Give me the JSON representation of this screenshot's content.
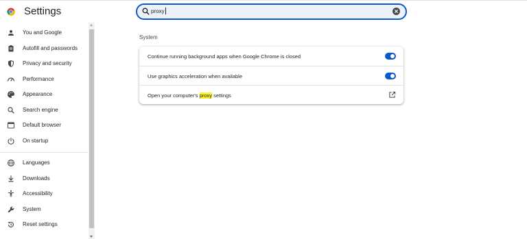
{
  "app": {
    "title": "Settings"
  },
  "search": {
    "value": "proxy"
  },
  "sidebar": {
    "items": [
      {
        "label": "You and Google",
        "icon": "person-icon"
      },
      {
        "label": "Autofill and passwords",
        "icon": "clipboard-icon"
      },
      {
        "label": "Privacy and security",
        "icon": "shield-icon"
      },
      {
        "label": "Performance",
        "icon": "speedometer-icon"
      },
      {
        "label": "Appearance",
        "icon": "palette-icon"
      },
      {
        "label": "Search engine",
        "icon": "search-icon"
      },
      {
        "label": "Default browser",
        "icon": "browser-icon"
      },
      {
        "label": "On startup",
        "icon": "power-icon"
      },
      {
        "label": "Languages",
        "icon": "globe-icon"
      },
      {
        "label": "Downloads",
        "icon": "download-icon"
      },
      {
        "label": "Accessibility",
        "icon": "accessibility-icon"
      },
      {
        "label": "System",
        "icon": "wrench-icon"
      },
      {
        "label": "Reset settings",
        "icon": "reset-icon"
      }
    ]
  },
  "main": {
    "section_title": "System",
    "rows": [
      {
        "label": "Continue running background apps when Google Chrome is closed",
        "control": "toggle",
        "checked": true
      },
      {
        "label": "Use graphics acceleration when available",
        "control": "toggle",
        "checked": true
      },
      {
        "label_before": "Open your computer's ",
        "label_highlight": "proxy",
        "label_after": " settings",
        "control": "external-link"
      }
    ]
  },
  "colors": {
    "accent": "#0b57d0",
    "highlight": "#f9f22f",
    "search_bg": "#edf2fa"
  }
}
